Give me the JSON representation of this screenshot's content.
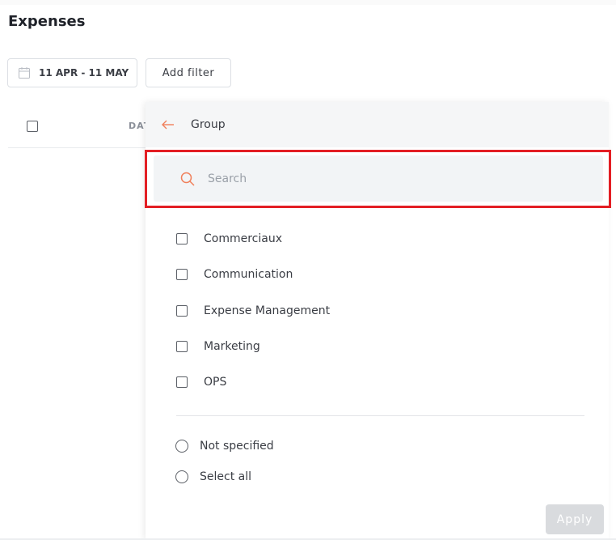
{
  "page": {
    "title": "Expenses"
  },
  "toolbar": {
    "date_range": "11 APR - 11 MAY",
    "add_filter_label": "Add filter"
  },
  "table": {
    "header_column": "DATE"
  },
  "filter_panel": {
    "title": "Group",
    "search": {
      "placeholder": "Search",
      "value": ""
    },
    "options": [
      {
        "label": "Commerciaux",
        "checked": false
      },
      {
        "label": "Communication",
        "checked": false
      },
      {
        "label": "Expense Management",
        "checked": false
      },
      {
        "label": "Marketing",
        "checked": false
      },
      {
        "label": "OPS",
        "checked": false
      }
    ],
    "extra_options": [
      {
        "label": "Not specified"
      },
      {
        "label": "Select all"
      }
    ],
    "apply_label": "Apply"
  },
  "colors": {
    "accent": "#f07f5a",
    "highlight": "#e31e24",
    "apply_disabled": "#d9dbde"
  },
  "icons": {
    "calendar": "calendar-icon",
    "back": "back-arrow-icon",
    "search": "search-icon"
  }
}
